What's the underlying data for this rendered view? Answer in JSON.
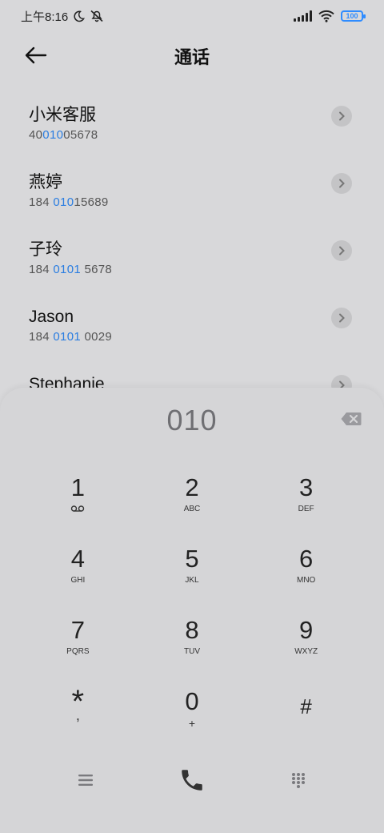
{
  "status_bar": {
    "time": "上午8:16",
    "battery": "100"
  },
  "header": {
    "title": "通话"
  },
  "contacts": [
    {
      "name": "小米客服",
      "number_pre": "40",
      "number_hl": "010",
      "number_post": "05678"
    },
    {
      "name": "燕婷",
      "number_pre": "184 ",
      "number_hl": "010",
      "number_post": "15689"
    },
    {
      "name": "子玲",
      "number_pre": "184 ",
      "number_hl": "0101",
      "number_post": " 5678"
    },
    {
      "name": "Jason",
      "number_pre": "184 ",
      "number_hl": "0101",
      "number_post": " 0029"
    },
    {
      "name": "Stephanie",
      "number_pre": "",
      "number_hl": "",
      "number_post": ""
    }
  ],
  "dialpad": {
    "entered": "010",
    "keys": [
      {
        "num": "1",
        "sub": ""
      },
      {
        "num": "2",
        "sub": "ABC"
      },
      {
        "num": "3",
        "sub": "DEF"
      },
      {
        "num": "4",
        "sub": "GHI"
      },
      {
        "num": "5",
        "sub": "JKL"
      },
      {
        "num": "6",
        "sub": "MNO"
      },
      {
        "num": "7",
        "sub": "PQRS"
      },
      {
        "num": "8",
        "sub": "TUV"
      },
      {
        "num": "9",
        "sub": "WXYZ"
      },
      {
        "num": "*",
        "sub": ","
      },
      {
        "num": "0",
        "sub": "+"
      },
      {
        "num": "#",
        "sub": ""
      }
    ]
  },
  "colors": {
    "accent": "#2a7de1",
    "background": "#d8d8da",
    "battery": "#2f8cff"
  },
  "icons": {
    "back": "arrow-left-icon",
    "chevron": "chevron-right-icon",
    "delete": "backspace-icon",
    "voicemail": "voicemail-icon",
    "menu": "menu-icon",
    "call": "phone-icon",
    "keypad": "keypad-icon"
  }
}
